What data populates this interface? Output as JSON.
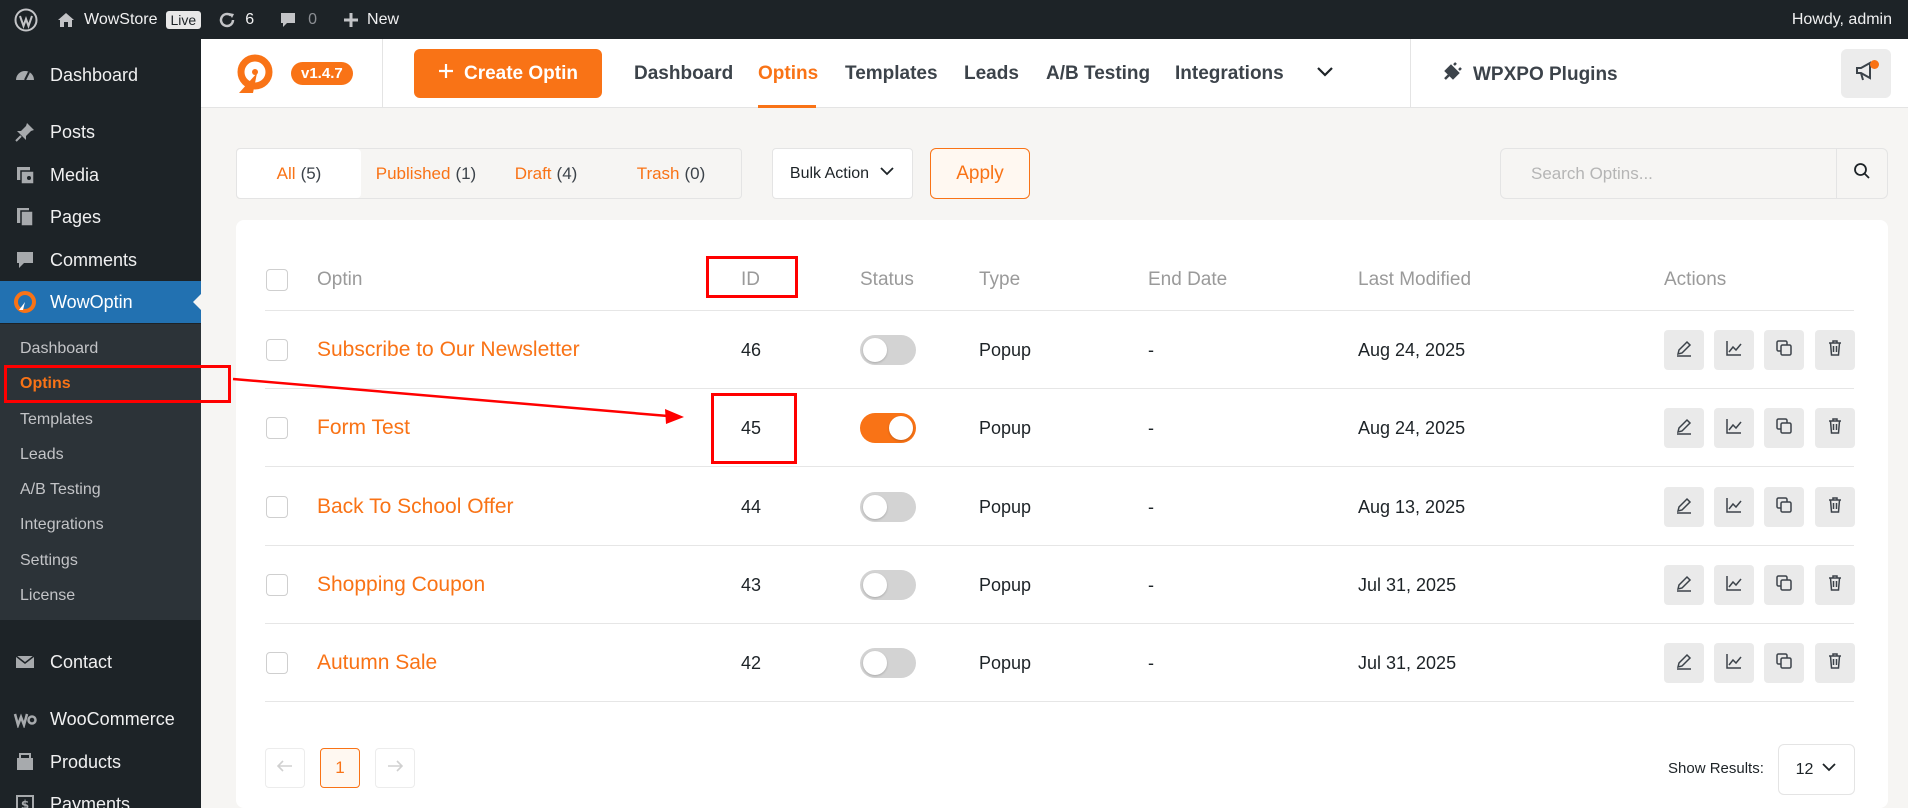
{
  "admin_bar": {
    "site_name": "WowStore",
    "live_badge": "Live",
    "updates_count": "6",
    "comments_count": "0",
    "new_label": "New",
    "howdy": "Howdy, admin"
  },
  "sidebar": {
    "items": [
      {
        "label": "Dashboard",
        "icon": "dashboard-icon"
      },
      {
        "label": "Posts",
        "icon": "pin-icon"
      },
      {
        "label": "Media",
        "icon": "media-icon"
      },
      {
        "label": "Pages",
        "icon": "pages-icon"
      },
      {
        "label": "Comments",
        "icon": "comment-icon"
      },
      {
        "label": "WowOptin",
        "icon": "wowoptin-icon"
      },
      {
        "label": "Contact",
        "icon": "envelope-icon"
      },
      {
        "label": "WooCommerce",
        "icon": "woo-icon"
      },
      {
        "label": "Products",
        "icon": "products-icon"
      },
      {
        "label": "Payments",
        "icon": "payments-icon"
      }
    ],
    "submenu": [
      "Dashboard",
      "Optins",
      "Templates",
      "Leads",
      "A/B Testing",
      "Integrations",
      "Settings",
      "License"
    ],
    "current_submenu": "Optins"
  },
  "topnav": {
    "version": "v1.4.7",
    "create_label": "Create Optin",
    "links": [
      "Dashboard",
      "Optins",
      "Templates",
      "Leads",
      "A/B Testing",
      "Integrations"
    ],
    "active_link": "Optins",
    "plugins_label": "WPXPO Plugins"
  },
  "filters": {
    "tabs": [
      {
        "label": "All",
        "count": "(5)"
      },
      {
        "label": "Published",
        "count": "(1)"
      },
      {
        "label": "Draft",
        "count": "(4)"
      },
      {
        "label": "Trash",
        "count": "(0)"
      }
    ],
    "bulk_action": "Bulk Action",
    "apply": "Apply",
    "search_placeholder": "Search Optins..."
  },
  "table": {
    "headers": [
      "Optin",
      "ID",
      "Status",
      "Type",
      "End Date",
      "Last Modified",
      "Actions"
    ],
    "rows": [
      {
        "title": "Subscribe to Our Newsletter",
        "id": "46",
        "status_on": false,
        "type": "Popup",
        "end_date": "-",
        "modified": "Aug 24, 2025"
      },
      {
        "title": "Form Test",
        "id": "45",
        "status_on": true,
        "type": "Popup",
        "end_date": "-",
        "modified": "Aug 24, 2025"
      },
      {
        "title": "Back To School Offer",
        "id": "44",
        "status_on": false,
        "type": "Popup",
        "end_date": "-",
        "modified": "Aug 13, 2025"
      },
      {
        "title": "Shopping Coupon",
        "id": "43",
        "status_on": false,
        "type": "Popup",
        "end_date": "-",
        "modified": "Jul 31, 2025"
      },
      {
        "title": "Autumn Sale",
        "id": "42",
        "status_on": false,
        "type": "Popup",
        "end_date": "-",
        "modified": "Jul 31, 2025"
      }
    ]
  },
  "pagination": {
    "current_page": "1",
    "show_results_label": "Show Results:",
    "per_page": "12"
  },
  "colors": {
    "accent": "#f97316",
    "admin_bar": "#1d2327",
    "active_menu": "#2271b1",
    "annotation": "#ff0000"
  }
}
